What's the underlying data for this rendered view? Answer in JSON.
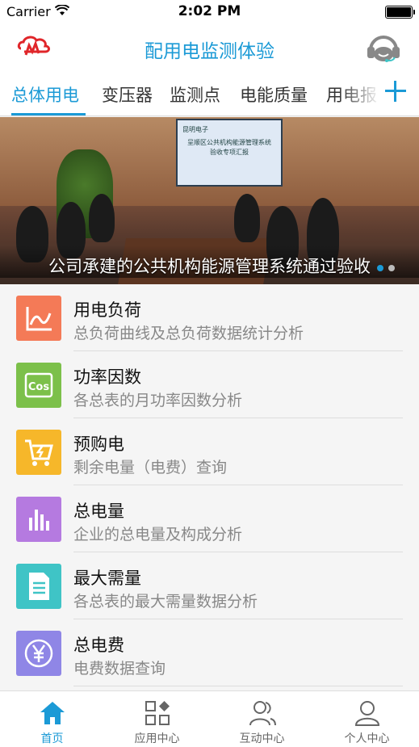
{
  "status_bar": {
    "carrier": "Carrier",
    "time": "2:02 PM"
  },
  "header": {
    "title": "配用电监测体验",
    "logo": "wl-logo",
    "right_icon": "customer-service-icon"
  },
  "tabs": [
    {
      "label": "总体用电",
      "active": true
    },
    {
      "label": "变压器",
      "active": false
    },
    {
      "label": "监测点",
      "active": false
    },
    {
      "label": "电能质量",
      "active": false
    },
    {
      "label": "用电报",
      "active": false
    }
  ],
  "banner": {
    "caption": "公司承建的公共机构能源管理系统通过验收",
    "screen_text_1": "昆明电子",
    "screen_text_2": "呈顺区公共机构能源管理系统",
    "screen_text_3": "验收专项汇报",
    "pages": 2,
    "current_page": 1
  },
  "menu": [
    {
      "title": "用电负荷",
      "subtitle": "总负荷曲线及总负荷数据统计分析",
      "icon": "line-chart-icon",
      "color": "#f47a57"
    },
    {
      "title": "功率因数",
      "subtitle": "各总表的月功率因数分析",
      "icon": "cos-icon",
      "color": "#7cc04a"
    },
    {
      "title": "预购电",
      "subtitle": "剩余电量（电费）查询",
      "icon": "cart-bolt-icon",
      "color": "#f6b72a"
    },
    {
      "title": "总电量",
      "subtitle": "企业的总电量及构成分析",
      "icon": "bar-chart-icon",
      "color": "#b57ae0"
    },
    {
      "title": "最大需量",
      "subtitle": "各总表的最大需量数据分析",
      "icon": "document-icon",
      "color": "#3fc4c6"
    },
    {
      "title": "总电费",
      "subtitle": "电费数据查询",
      "icon": "yen-icon",
      "color": "#8f86e6"
    }
  ],
  "tabbar": [
    {
      "label": "首页",
      "icon": "home-icon",
      "active": true
    },
    {
      "label": "应用中心",
      "icon": "apps-icon",
      "active": false
    },
    {
      "label": "互动中心",
      "icon": "people-icon",
      "active": false
    },
    {
      "label": "个人中心",
      "icon": "person-icon",
      "active": false
    }
  ],
  "colors": {
    "accent": "#1b9ad6"
  }
}
